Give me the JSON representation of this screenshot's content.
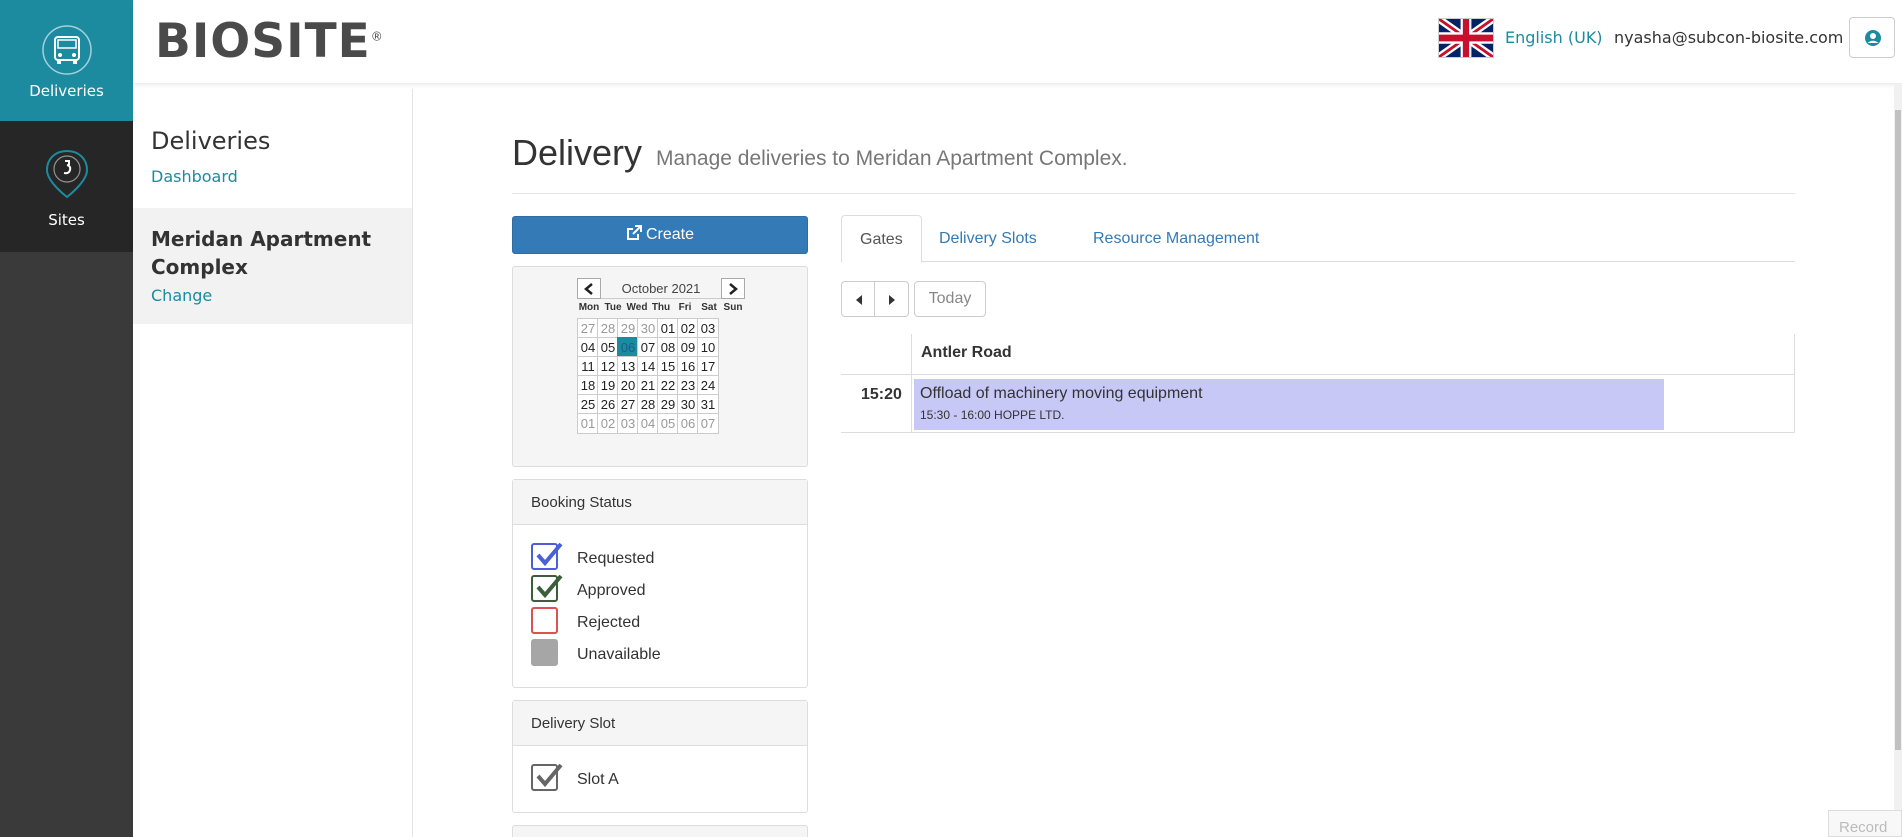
{
  "leftnav": {
    "items": [
      {
        "label": "Deliveries",
        "icon": "truck-icon",
        "active": true
      },
      {
        "label": "Sites",
        "icon": "map-pin-icon",
        "active": false
      }
    ]
  },
  "header": {
    "logo_text": "BIOSITE",
    "logo_mark": "®",
    "language": "English (UK)",
    "user_email": "nyasha@subcon-biosite.com"
  },
  "sidenav": {
    "title": "Deliveries",
    "dashboard_link": "Dashboard",
    "site_name": "Meridan Apartment Complex",
    "change_link": "Change"
  },
  "main": {
    "title": "Delivery",
    "subtitle": "Manage deliveries to Meridan Apartment Complex.",
    "create_label": "Create"
  },
  "calendar": {
    "month_label": "October 2021",
    "weekdays": [
      "Mon",
      "Tue",
      "Wed",
      "Thu",
      "Fri",
      "Sat",
      "Sun"
    ],
    "weeks": [
      [
        "27",
        "28",
        "29",
        "30",
        "01",
        "02",
        "03"
      ],
      [
        "04",
        "05",
        "06",
        "07",
        "08",
        "09",
        "10"
      ],
      [
        "11",
        "12",
        "13",
        "14",
        "15",
        "16",
        "17"
      ],
      [
        "18",
        "19",
        "20",
        "21",
        "22",
        "23",
        "24"
      ],
      [
        "25",
        "26",
        "27",
        "28",
        "29",
        "30",
        "31"
      ],
      [
        "01",
        "02",
        "03",
        "04",
        "05",
        "06",
        "07"
      ]
    ],
    "selected": "06"
  },
  "booking_status": {
    "title": "Booking Status",
    "items": [
      {
        "label": "Requested",
        "color": "#4a5fd8",
        "checked": true
      },
      {
        "label": "Approved",
        "color": "#3b5e3b",
        "checked": true
      },
      {
        "label": "Rejected",
        "color": "#d9534f",
        "checked": false
      },
      {
        "label": "Unavailable",
        "color": "#a6a6a6",
        "checked": false
      }
    ]
  },
  "delivery_slot": {
    "title": "Delivery Slot",
    "items": [
      {
        "label": "Slot A",
        "color": "#666666",
        "checked": true
      }
    ]
  },
  "tabs": [
    {
      "label": "Gates",
      "active": true
    },
    {
      "label": "Delivery Slots",
      "active": false
    },
    {
      "label": "Resource Management",
      "active": false
    }
  ],
  "scheduler": {
    "today_label": "Today",
    "column": "Antler Road",
    "time": "15:20",
    "event": {
      "title": "Offload of machinery moving equipment",
      "detail": "15:30 - 16:00 HOPPE LTD."
    }
  },
  "record_label": "Record",
  "colors": {
    "accent": "#1c8ba0",
    "primary_button": "#337ab7",
    "event_bg": "#c8c8f7",
    "nav_bg": "#3a3a3a"
  }
}
